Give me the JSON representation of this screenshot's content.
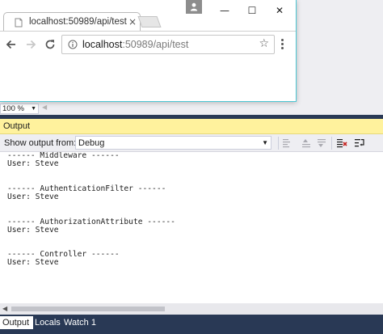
{
  "browser": {
    "tab_title": "localhost:50989/api/test",
    "tab_close": "×",
    "url_host": "localhost",
    "url_rest": ":50989/api/test",
    "window_controls": {
      "minimize": "—",
      "maximize": "☐",
      "close": "✕"
    },
    "star": "☆"
  },
  "editor": {
    "zoom": "100 %",
    "zoom_arrow": "▼",
    "scroll_arrow": "◀"
  },
  "output": {
    "title": "Output",
    "show_output_label": "Show output from:",
    "source": "Debug",
    "source_arrow": "▼",
    "lines": [
      "------ Middleware ------",
      "User: Steve",
      "",
      "",
      "------ AuthenticationFilter ------",
      "User: Steve",
      "",
      "",
      "------ AuthorizationAttribute ------",
      "User: Steve",
      "",
      "",
      "------ Controller ------",
      "User: Steve",
      "",
      ""
    ],
    "scroll_arrow": "◀"
  },
  "bottom_tabs": [
    "Output",
    "Locals",
    "Watch 1"
  ],
  "colors": {
    "vs_dark_blue": "#293955",
    "output_header": "#fff29d",
    "browser_border": "#4ec7d4"
  }
}
